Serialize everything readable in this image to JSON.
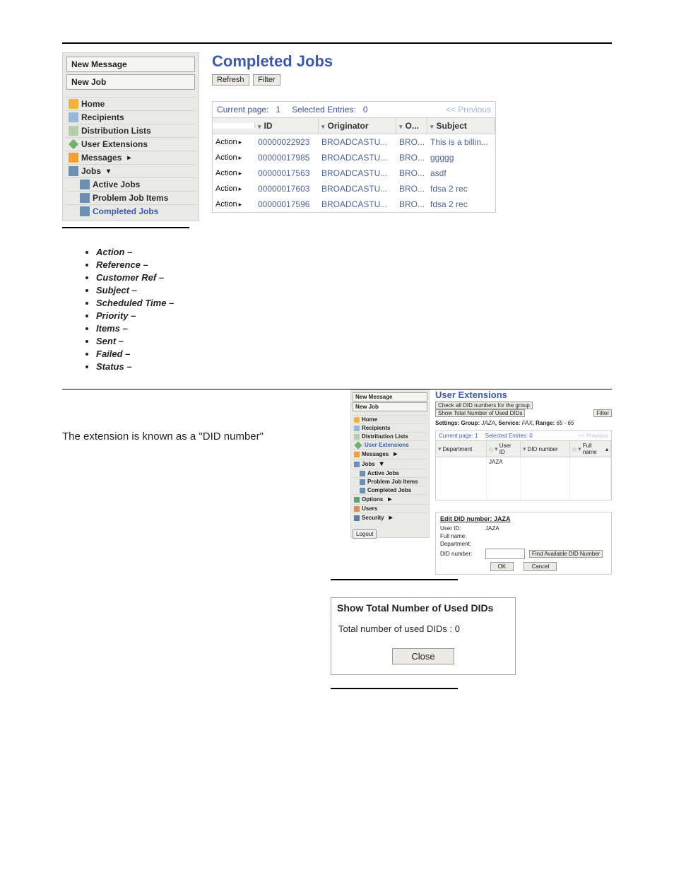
{
  "sidebar": {
    "new_message_label": "New Message",
    "new_job_label": "New Job",
    "items": {
      "home": "Home",
      "recipients": "Recipients",
      "distribution_lists": "Distribution Lists",
      "user_extensions": "User Extensions",
      "messages": "Messages",
      "jobs": "Jobs",
      "active_jobs": "Active Jobs",
      "problem_job_items": "Problem Job Items",
      "completed_jobs": "Completed Jobs"
    }
  },
  "completed_jobs": {
    "title": "Completed Jobs",
    "refresh_label": "Refresh",
    "filter_label": "Filter",
    "info": {
      "current_page_label": "Current page:",
      "current_page_value": "1",
      "selected_label": "Selected Entries:",
      "selected_value": "0",
      "previous_label": "<< Previous"
    },
    "columns": {
      "id": "ID",
      "originator": "Originator",
      "owner": "O...",
      "subject": "Subject"
    },
    "rows": [
      {
        "action": "Action",
        "id": "00000022923",
        "originator": "BROADCASTU...",
        "owner": "BRO...",
        "subject": "This is a billin..."
      },
      {
        "action": "Action",
        "id": "00000017985",
        "originator": "BROADCASTU...",
        "owner": "BRO...",
        "subject": "ggggg"
      },
      {
        "action": "Action",
        "id": "00000017563",
        "originator": "BROADCASTU...",
        "owner": "BRO...",
        "subject": "asdf"
      },
      {
        "action": "Action",
        "id": "00000017603",
        "originator": "BROADCASTU...",
        "owner": "BRO...",
        "subject": "fdsa 2 rec"
      },
      {
        "action": "Action",
        "id": "00000017596",
        "originator": "BROADCASTU...",
        "owner": "BRO...",
        "subject": "fdsa 2 rec"
      }
    ]
  },
  "bullets": [
    "Action",
    "Reference",
    "Customer Ref",
    "Subject",
    "Scheduled Time",
    "Priority",
    "Items",
    "Sent",
    "Failed",
    "Status"
  ],
  "ue_caption": "The extension is known as a \"DID number\"",
  "user_extensions": {
    "sidebar": {
      "new_message_label": "New Message",
      "new_job_label": "New Job",
      "items": {
        "home": "Home",
        "recipients": "Recipients",
        "distribution_lists": "Distribution Lists",
        "user_extensions": "User Extensions",
        "messages": "Messages",
        "jobs": "Jobs",
        "active_jobs": "Active Jobs",
        "problem_job_items": "Problem Job Items",
        "completed_jobs": "Completed Jobs",
        "options": "Options",
        "users": "Users",
        "security": "Security"
      },
      "logout_label": "Logout"
    },
    "title": "User Extensions",
    "top_buttons": {
      "check_all": "Check all DID numbers for the group",
      "show_total": "Show Total Number of Used DIDs",
      "filter": "Filter"
    },
    "settings_line": {
      "prefix": "Settings: Group: ",
      "group": "JAZA",
      "service_label": ", Service: ",
      "service": "FAX",
      "range_label": ", Range: ",
      "range": "65 - 65"
    },
    "info": {
      "current_page_label": "Current page:",
      "current_page_value": "1",
      "selected_label": "Selected Entries:",
      "selected_value": "0",
      "previous_label": "<< Previous"
    },
    "columns": {
      "department": "Department",
      "user_id": "User ID",
      "did_number": "DID number",
      "full_name": "Full name"
    },
    "body": {
      "user_id": "JAZA"
    },
    "edit": {
      "title": "Edit DID number: JAZA",
      "user_id_label": "User ID:",
      "user_id_value": "JAZA",
      "full_name_label": "Full name:",
      "department_label": "Department:",
      "did_number_label": "DID number:",
      "find_btn": "Find Available DID Number",
      "ok_label": "OK",
      "cancel_label": "Cancel"
    }
  },
  "did_dialog": {
    "title": "Show Total Number of Used DIDs",
    "body": "Total number of used DIDs : 0",
    "close_label": "Close"
  }
}
